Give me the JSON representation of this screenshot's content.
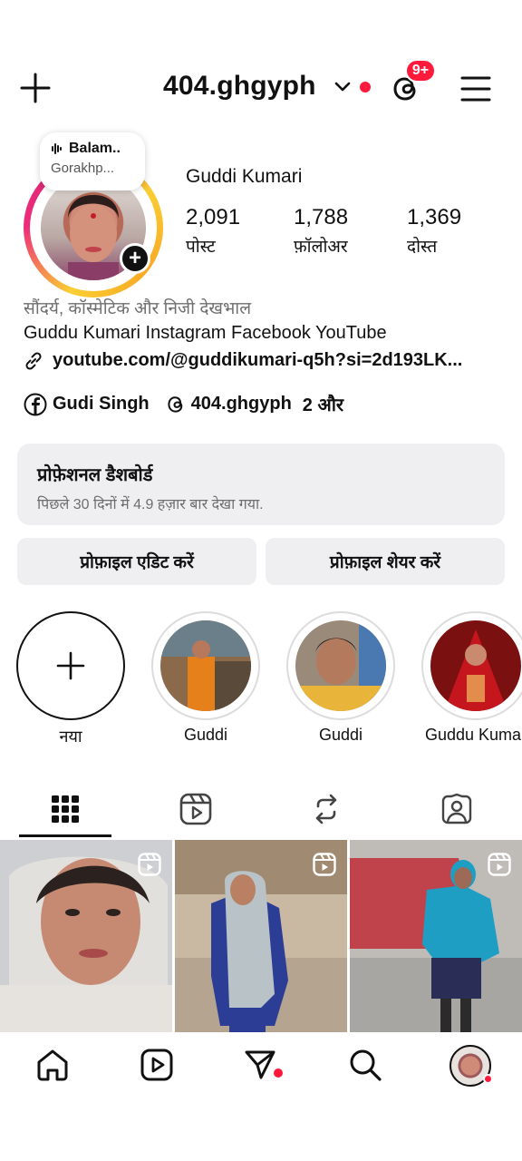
{
  "header": {
    "username": "404.ghgyph",
    "threads_badge": "9+"
  },
  "profile": {
    "note_title": "Balam..",
    "note_subtitle": "Gorakhp...",
    "full_name": "Guddi Kumari",
    "stats": [
      {
        "value": "2,091",
        "label": "पोस्ट"
      },
      {
        "value": "1,788",
        "label": "फ़ॉलोअर"
      },
      {
        "value": "1,369",
        "label": "दोस्त"
      }
    ],
    "category": "सौंदर्य, कॉस्मेटिक और निजी देखभाल",
    "bio": "Guddu Kumari Instagram Facebook YouTube",
    "link": "youtube.com/@guddikumari-q5h?si=2d193LK...",
    "social": {
      "facebook": "Gudi Singh",
      "threads": "404.ghgyph",
      "more": "2 और"
    }
  },
  "dashboard": {
    "title": "प्रोफ़ेशनल डैशबोर्ड",
    "subtitle": "पिछले 30 दिनों में 4.9 हज़ार बार देखा गया."
  },
  "actions": {
    "edit": "प्रोफ़ाइल एडिट करें",
    "share": "प्रोफ़ाइल शेयर करें"
  },
  "highlights": [
    {
      "label": "नया"
    },
    {
      "label": "Guddi"
    },
    {
      "label": "Guddi"
    },
    {
      "label": "Guddu Kumar"
    }
  ],
  "tabs": [
    "grid-icon",
    "reels-icon",
    "reposts-icon",
    "tagged-icon"
  ],
  "nav": [
    "home-icon",
    "reels-icon",
    "direct-icon",
    "search-icon",
    "profile-avatar"
  ],
  "colors": {
    "accent_red": "#ff1a3c",
    "button_bg": "#efeff2",
    "text": "#111111"
  }
}
